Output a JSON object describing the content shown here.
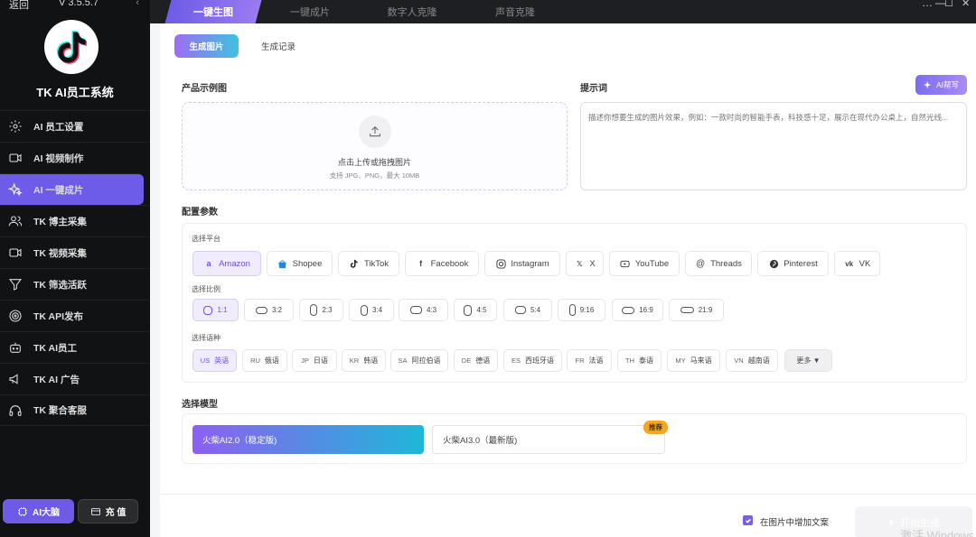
{
  "sidebar": {
    "back_label": "返回",
    "version": "V 3.5.5.7",
    "collapse_glyph": "‹",
    "app_title": "TK AI员工系统",
    "items": [
      {
        "label": "AI 员工设置",
        "icon": "gear-icon"
      },
      {
        "label": "AI 视频制作",
        "icon": "video-icon"
      },
      {
        "label": "AI 一键成片",
        "icon": "sparkle-icon",
        "active": true
      },
      {
        "label": "TK 博主采集",
        "icon": "users-icon"
      },
      {
        "label": "TK 视频采集",
        "icon": "video-collect-icon"
      },
      {
        "label": "TK 筛选活跃",
        "icon": "filter-icon"
      },
      {
        "label": "TK API发布",
        "icon": "target-icon"
      },
      {
        "label": "TK AI员工",
        "icon": "robot-icon"
      },
      {
        "label": "TK AI 广告",
        "icon": "megaphone-icon"
      },
      {
        "label": "TK 聚合客服",
        "icon": "headset-icon"
      }
    ],
    "brain_label": "AI大脑",
    "charge_label": "充 值"
  },
  "tabs": [
    "一键生图",
    "一键成片",
    "数字人克隆",
    "声音克隆"
  ],
  "window_controls": [
    "…",
    "—",
    "☐",
    "✕"
  ],
  "segments": {
    "generate": "生成图片",
    "history": "生成记录"
  },
  "upload": {
    "label": "产品示例图",
    "hint": "点击上传或拖拽图片",
    "formats": "支持 JPG、PNG，最大 10MB"
  },
  "prompt": {
    "label": "提示词",
    "ai_write": "AI帮写",
    "placeholder": "描述你想要生成的图片效果，例如：一款时尚的智能手表，科技感十足，展示在现代办公桌上，自然光线..."
  },
  "config": {
    "title": "配置参数",
    "platform_label": "选择平台",
    "platforms": [
      {
        "name": "Amazon",
        "icon": "amazon-icon",
        "selected": true
      },
      {
        "name": "Shopee",
        "icon": "shopee-icon"
      },
      {
        "name": "TikTok",
        "icon": "tiktok-icon"
      },
      {
        "name": "Facebook",
        "icon": "facebook-icon"
      },
      {
        "name": "Instagram",
        "icon": "instagram-icon"
      },
      {
        "name": "X",
        "icon": "x-icon"
      },
      {
        "name": "YouTube",
        "icon": "youtube-icon"
      },
      {
        "name": "Threads",
        "icon": "threads-icon"
      },
      {
        "name": "Pinterest",
        "icon": "pinterest-icon"
      },
      {
        "name": "VK",
        "icon": "vk-icon"
      }
    ],
    "ratio_label": "选择比例",
    "ratios": [
      "1:1",
      "3:2",
      "2:3",
      "3:4",
      "4:3",
      "4:5",
      "5:4",
      "9:16",
      "16:9",
      "21:9"
    ],
    "language_label": "选择语种",
    "languages": [
      {
        "code": "US",
        "name": "英语",
        "selected": true
      },
      {
        "code": "RU",
        "name": "俄语"
      },
      {
        "code": "JP",
        "name": "日语"
      },
      {
        "code": "KR",
        "name": "韩语"
      },
      {
        "code": "SA",
        "name": "阿拉伯语"
      },
      {
        "code": "DE",
        "name": "德语"
      },
      {
        "code": "ES",
        "name": "西班牙语"
      },
      {
        "code": "FR",
        "name": "法语"
      },
      {
        "code": "TH",
        "name": "泰语"
      },
      {
        "code": "MY",
        "name": "马来语"
      },
      {
        "code": "VN",
        "name": "越南语"
      }
    ],
    "more_label": "更多 ▼"
  },
  "model": {
    "title": "选择模型",
    "options": [
      {
        "name": "火柴AI2.0（稳定版)",
        "selected": true
      },
      {
        "name": "火柴AI3.0（最新版)",
        "badge": "推荐"
      }
    ]
  },
  "footer": {
    "checkbox_label": "在图片中增加文案",
    "checked": true,
    "generate_label": "开始生成"
  },
  "watermark": "激活 Windows",
  "colors": {
    "accent": "#6c5ce7",
    "sidebar_bg": "#111214",
    "badge": "#f5a623"
  }
}
